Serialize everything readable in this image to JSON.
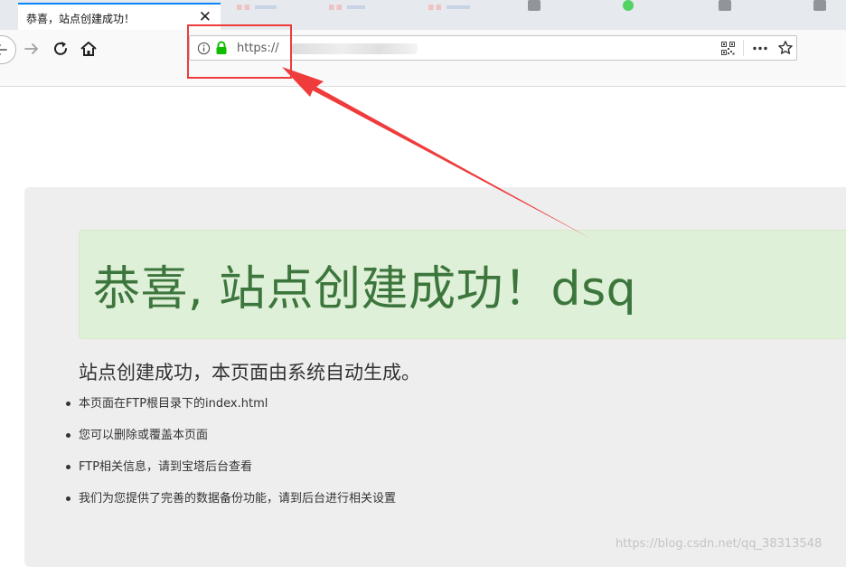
{
  "tab": {
    "title": "恭喜，站点创建成功！",
    "close": "✕"
  },
  "address_bar": {
    "url": "https://"
  },
  "page": {
    "heading": "恭喜, 站点创建成功！dsq",
    "subtitle": "站点创建成功，本页面由系统自动生成。",
    "items": [
      "本页面在FTP根目录下的index.html",
      "您可以删除或覆盖本页面",
      "FTP相关信息，请到宝塔后台查看",
      "我们为您提供了完善的数据备份功能，请到后台进行相关设置"
    ]
  },
  "watermark": "https://blog.csdn.net/qq_38313548",
  "colors": {
    "alert_bg": "#dff0d8",
    "alert_text": "#3c763d",
    "annotation": "#ef3b3b",
    "lock": "#12bc00",
    "tab_accent": "#0a84ff"
  },
  "icons": [
    "back-icon",
    "forward-icon",
    "reload-icon",
    "home-icon",
    "info-icon",
    "lock-icon",
    "qr-code-icon",
    "more-icon",
    "star-icon"
  ]
}
